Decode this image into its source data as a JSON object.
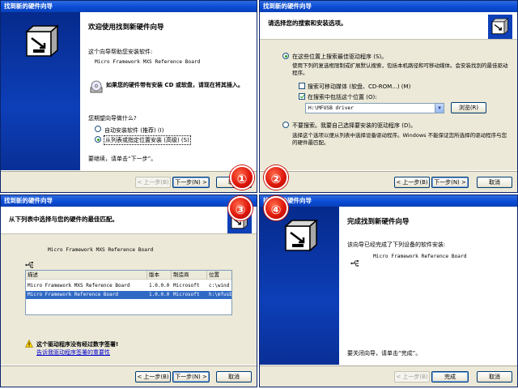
{
  "win1": {
    "title": "找到新的硬件向导",
    "heading": "欢迎使用找到新硬件向导",
    "intro": "这个向导帮助您安装软件:",
    "device": "Micro Framework MXS Reference Board",
    "cd_hint": "如果您的硬件带有安装 CD 或软盘，请现在将其插入。",
    "question": "您期望向导做什么?",
    "opt_auto": "自动安装软件 (推荐) (I)",
    "opt_manual": "从列表或指定位置安装 (高级) (S)",
    "continue": "要继续，请单击“下一步”。",
    "back": "< 上一步(B)",
    "next": "下一步(N) >",
    "cancel": "取消"
  },
  "win2": {
    "title": "找到新的硬件向导",
    "heading": "请选择您的搜索和安装选项。",
    "opt_search": "在这些位置上搜索最佳驱动程序 (S)。",
    "search_desc": "使用下列的复选框限制或扩展默认搜索，包括本机路径和可移动媒体。会安装找到的最佳驱动程序。",
    "chk_removable": "搜索可移动媒体 (软盘、CD-ROM...) (M)",
    "chk_include": "在搜索中包括这个位置 (O):",
    "path": "H:\\MFUSB driver",
    "browse": "浏览(R)",
    "opt_nosearch": "不要搜索。我要自己选择要安装的驱动程序 (D)。",
    "nosearch_desc": "选择这个选项以便从列表中选择设备驱动程序。Windows 不能保证您所选择的驱动程序与您的硬件最匹配。",
    "back": "< 上一步(B)",
    "next": "下一步(N) >",
    "cancel": "取消"
  },
  "win3": {
    "title": "找到新的硬件向导",
    "heading": "从下列表中选择与您的硬件的最佳匹配。",
    "device": "Micro Framework MXS Reference Board",
    "columns": [
      "描述",
      "版本",
      "制造商",
      "位置"
    ],
    "rows": [
      [
        "Micro Framework MXS Reference Board",
        "1.0.0.0",
        "Microsoft",
        "c:\\wind"
      ],
      [
        "Micro Framework Reference Board",
        "1.0.0.0",
        "Microsoft",
        "h:\\mfusb"
      ]
    ],
    "warning": "这个驱动程序没有经过数字签署!",
    "link": "告诉我驱动程序签署的重要性",
    "back": "< 上一步(B)",
    "next": "下一步(N) >",
    "cancel": "取消"
  },
  "win4": {
    "title": "找到新的硬件向导",
    "heading": "完成找到新硬件向导",
    "done_text": "该向导已经完成了下列设备的软件安装:",
    "device": "Micro Framework Reference Board",
    "close_hint": "要关闭向导，请单击“完成”。",
    "back": "< 上一步(B)",
    "finish": "完成",
    "cancel": "取消"
  },
  "badges": [
    "①",
    "②",
    "③",
    "④"
  ]
}
